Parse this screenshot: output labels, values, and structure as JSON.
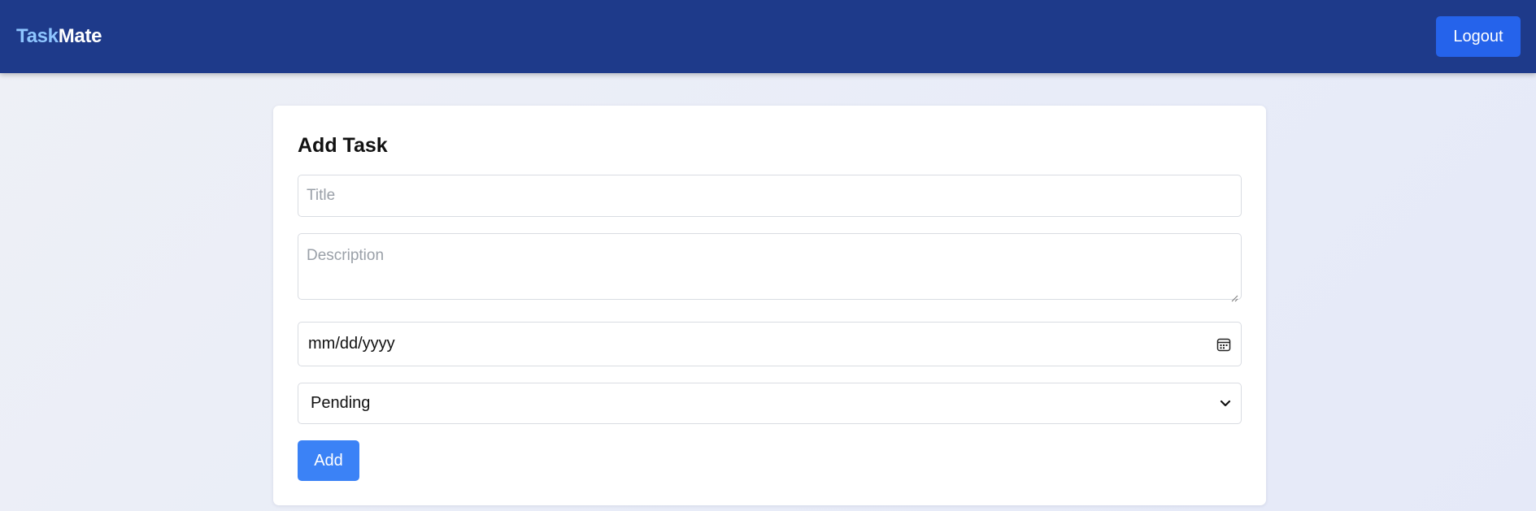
{
  "navbar": {
    "brand_part1": "Task",
    "brand_part2": "Mate",
    "logout_label": "Logout"
  },
  "form": {
    "heading": "Add Task",
    "title_placeholder": "Title",
    "description_placeholder": "Description",
    "date_value": "mm/dd/yyyy",
    "date_icon": "calendar-icon",
    "status_selected": "Pending",
    "status_icon": "chevron-down-icon",
    "submit_label": "Add"
  },
  "colors": {
    "navbar_bg": "#1e3a8a",
    "brand_accent": "#8ec5ff",
    "logout_bg": "#2563eb",
    "add_bg": "#3b82f6"
  }
}
